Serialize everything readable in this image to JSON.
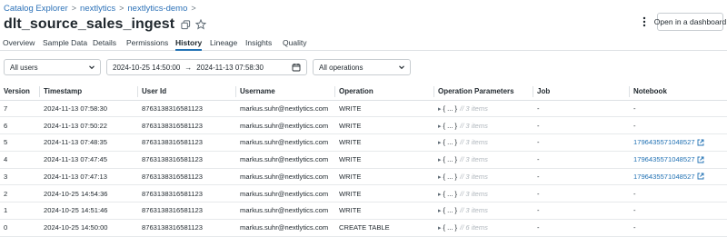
{
  "breadcrumb": {
    "items": [
      "Catalog Explorer",
      "nextlytics",
      "nextlytics-demo"
    ],
    "separator": ">"
  },
  "title": "dlt_source_sales_ingest",
  "header": {
    "open_dashboard_label": "Open in a dashboard",
    "copy_icon": "copy-icon",
    "favorite_icon": "star-icon",
    "more_icon": "kebab-icon"
  },
  "tabs": [
    "Overview",
    "Sample Data",
    "Details",
    "Permissions",
    "History",
    "Lineage",
    "Insights",
    "Quality"
  ],
  "active_tab": "History",
  "filters": {
    "users": "All users",
    "start": "2024-10-25 14:50:00",
    "arrow": "→",
    "end": "2024-11-13 07:58:30",
    "operations": "All operations"
  },
  "table": {
    "headers": [
      "Version",
      "Timestamp",
      "User Id",
      "Username",
      "Operation",
      "Operation Parameters",
      "Job",
      "Notebook"
    ],
    "rows": [
      {
        "version": "7",
        "timestamp": "2024-11-13 07:58:30",
        "user_id": "8763138316581123",
        "username": "markus.suhr@nextlytics.com",
        "operation": "WRITE",
        "params_brace": "{ ... }",
        "params_items": "// 3 items",
        "job": "-",
        "notebook": "-"
      },
      {
        "version": "6",
        "timestamp": "2024-11-13 07:50:22",
        "user_id": "8763138316581123",
        "username": "markus.suhr@nextlytics.com",
        "operation": "WRITE",
        "params_brace": "{ ... }",
        "params_items": "// 3 items",
        "job": "-",
        "notebook": "-"
      },
      {
        "version": "5",
        "timestamp": "2024-11-13 07:48:35",
        "user_id": "8763138316581123",
        "username": "markus.suhr@nextlytics.com",
        "operation": "WRITE",
        "params_brace": "{ ... }",
        "params_items": "// 3 items",
        "job": "-",
        "notebook": "1796435571048527"
      },
      {
        "version": "4",
        "timestamp": "2024-11-13 07:47:45",
        "user_id": "8763138316581123",
        "username": "markus.suhr@nextlytics.com",
        "operation": "WRITE",
        "params_brace": "{ ... }",
        "params_items": "// 3 items",
        "job": "-",
        "notebook": "1796435571048527"
      },
      {
        "version": "3",
        "timestamp": "2024-11-13 07:47:13",
        "user_id": "8763138316581123",
        "username": "markus.suhr@nextlytics.com",
        "operation": "WRITE",
        "params_brace": "{ ... }",
        "params_items": "// 3 items",
        "job": "-",
        "notebook": "1796435571048527"
      },
      {
        "version": "2",
        "timestamp": "2024-10-25 14:54:36",
        "user_id": "8763138316581123",
        "username": "markus.suhr@nextlytics.com",
        "operation": "WRITE",
        "params_brace": "{ ... }",
        "params_items": "// 3 items",
        "job": "-",
        "notebook": "-"
      },
      {
        "version": "1",
        "timestamp": "2024-10-25 14:51:46",
        "user_id": "8763138316581123",
        "username": "markus.suhr@nextlytics.com",
        "operation": "WRITE",
        "params_brace": "{ ... }",
        "params_items": "// 3 items",
        "job": "-",
        "notebook": "-"
      },
      {
        "version": "0",
        "timestamp": "2024-10-25 14:50:00",
        "user_id": "8763138316581123",
        "username": "markus.suhr@nextlytics.com",
        "operation": "CREATE TABLE",
        "params_brace": "{ ... }",
        "params_items": "// 6 items",
        "job": "-",
        "notebook": "-"
      }
    ]
  },
  "colors": {
    "link": "#2272b4",
    "active_tab_underline": "#2272b4",
    "text": "#1f272d",
    "muted": "#b0b7bd"
  }
}
